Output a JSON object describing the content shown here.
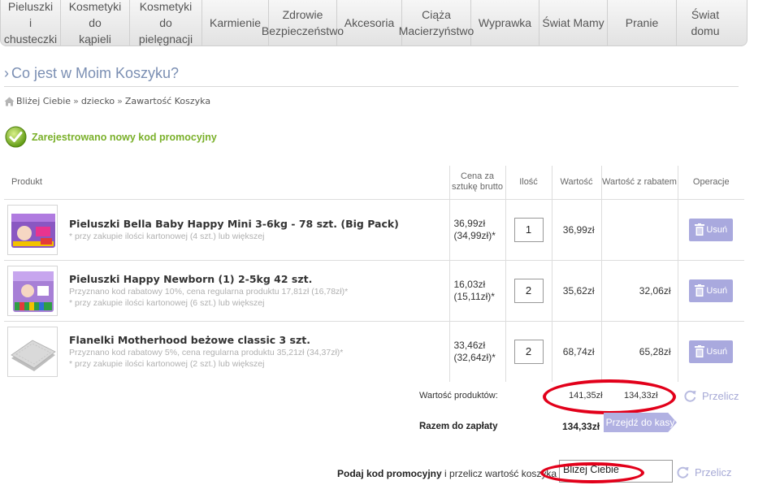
{
  "nav": {
    "items": [
      {
        "label": "Pieluszki\ni chusteczki"
      },
      {
        "label": "Kosmetyki do\nkąpieli"
      },
      {
        "label": "Kosmetyki do\npielęgnacji"
      },
      {
        "label": "Karmienie"
      },
      {
        "label": "Zdrowie\nBezpieczeństwo"
      },
      {
        "label": "Akcesoria"
      },
      {
        "label": "Ciąża\nMacierzyństwo"
      },
      {
        "label": "Wyprawka"
      },
      {
        "label": "Świat Mamy"
      },
      {
        "label": "Pranie"
      },
      {
        "label": "Świat domu"
      }
    ]
  },
  "page": {
    "title": "Co jest w Moim Koszyku?",
    "breadcrumb": [
      "Bliżej Ciebie",
      "dziecko",
      "Zawartość Koszyka"
    ],
    "breadcrumb_sep": "»",
    "notice": "Zarejestrowano nowy kod promocyjny"
  },
  "table": {
    "headers": {
      "product": "Produkt",
      "unit_price": "Cena za sztukę brutto",
      "qty": "Ilość",
      "value": "Wartość",
      "discounted": "Wartość z rabatem",
      "operations": "Operacje"
    },
    "rows": [
      {
        "name": "Pieluszki Bella Baby Happy Mini 3-6kg - 78 szt. (Big Pack)",
        "note1": "* przy zakupie ilości kartonowej (4 szt.) lub większej",
        "note2": "",
        "price": "36,99zł",
        "price2": "(34,99zł)*",
        "qty": "1",
        "value": "36,99zł",
        "discounted": "",
        "remove_label": "Usuń"
      },
      {
        "name": "Pieluszki Happy Newborn (1) 2-5kg 42 szt.",
        "note1": "Przyznano kod rabatowy 10%,  cena regularna produktu 17,81zł (16,78zł)*",
        "note2": "* przy zakupie ilości kartonowej (6 szt.) lub większej",
        "price": "16,03zł",
        "price2": "(15,11zł)*",
        "qty": "2",
        "value": "35,62zł",
        "discounted": "32,06zł",
        "remove_label": "Usuń"
      },
      {
        "name": "Flanelki Motherhood beżowe classic 3 szt.",
        "note1": "Przyznano kod rabatowy 5%,  cena regularna produktu 35,21zł (34,37zł)*",
        "note2": "* przy zakupie ilości kartonowej (2 szt.) lub większej",
        "price": "33,46zł",
        "price2": "(32,64zł)*",
        "qty": "2",
        "value": "68,74zł",
        "discounted": "65,28zł",
        "remove_label": "Usuń"
      }
    ]
  },
  "totals": {
    "products_label": "Wartość produktów:",
    "products_value": "141,35zł",
    "products_discounted": "134,33zł",
    "recalc_label": "Przelicz",
    "pay_label": "Razem do zapłaty",
    "pay_value": "134,33zł",
    "checkout_label": "Przejdź do kasy"
  },
  "promo": {
    "label_bold": "Podaj kod promocyjny",
    "label_rest": " i przelicz wartość koszyka",
    "input_value": "Bliżej Ciebie",
    "recalc_label": "Przelicz"
  },
  "colors": {
    "highlight": "#e2001a",
    "accent": "#a9a9de",
    "success": "#7ab02a",
    "title": "#7b8fb3"
  }
}
